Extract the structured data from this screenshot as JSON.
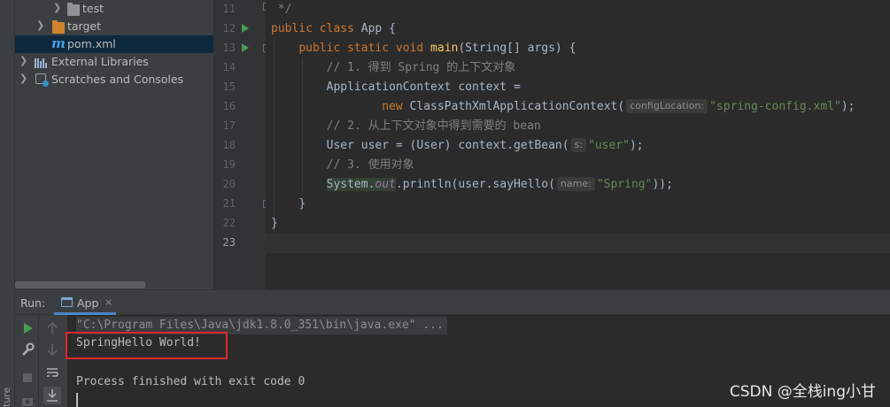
{
  "tool_strip": {
    "label": "ture"
  },
  "project_tree": {
    "items": [
      {
        "label": "test",
        "icon": "folder-icon"
      },
      {
        "label": "target",
        "icon": "folder-orange-icon"
      },
      {
        "label": "pom.xml",
        "icon": "maven-icon",
        "selected": true
      },
      {
        "label": "External Libraries",
        "icon": "library-icon"
      },
      {
        "label": "Scratches and Consoles",
        "icon": "scratch-icon"
      }
    ]
  },
  "editor": {
    "line_numbers": [
      "11",
      "12",
      "13",
      "14",
      "15",
      "16",
      "17",
      "18",
      "19",
      "20",
      "21",
      "22",
      "23"
    ],
    "lines": {
      "l11": {
        "comment": " */"
      },
      "l12": {
        "kw1": "public",
        "kw2": "class",
        "name": "App",
        "brace": "{"
      },
      "l13": {
        "kw1": "public",
        "kw2": "static",
        "kw3": "void",
        "method": "main",
        "params": "(String[] args) {"
      },
      "l14": {
        "comment": "// 1. 得到 Spring 的上下文对象"
      },
      "l15": {
        "code": "ApplicationContext context ="
      },
      "l16": {
        "kw": "new",
        "code": "ClassPathXmlApplicationContext(",
        "hint": "configLocation:",
        "str": "\"spring-config.xml\"",
        "tail": ");"
      },
      "l17": {
        "comment": "// 2. 从上下文对象中得到需要的 bean"
      },
      "l18": {
        "code": "User user = (User) context.getBean(",
        "hint": "s:",
        "str": "\"user\"",
        "tail": ");"
      },
      "l19": {
        "comment": "// 3. 使用对象"
      },
      "l20": {
        "sys": "System",
        "dot": ".",
        "field": "out",
        "code": ".println(user.sayHello(",
        "hint": "name:",
        "str": "\"Spring\"",
        "tail": "));"
      },
      "l21": {
        "brace": "}"
      },
      "l22": {
        "brace": "}"
      }
    }
  },
  "run_panel": {
    "title": "Run:",
    "tab_label": "App",
    "tab_close": "×",
    "command": "\"C:\\Program Files\\Java\\jdk1.8.0_351\\bin\\java.exe\" ...",
    "output": "SpringHello World!",
    "exit_message": "Process finished with exit code 0"
  },
  "watermark": "CSDN @全栈ing小甘",
  "colors": {
    "keyword": "#cc7832",
    "method": "#ffc66d",
    "string": "#6a8759",
    "comment": "#808080",
    "highlight_box": "#e0282b"
  }
}
